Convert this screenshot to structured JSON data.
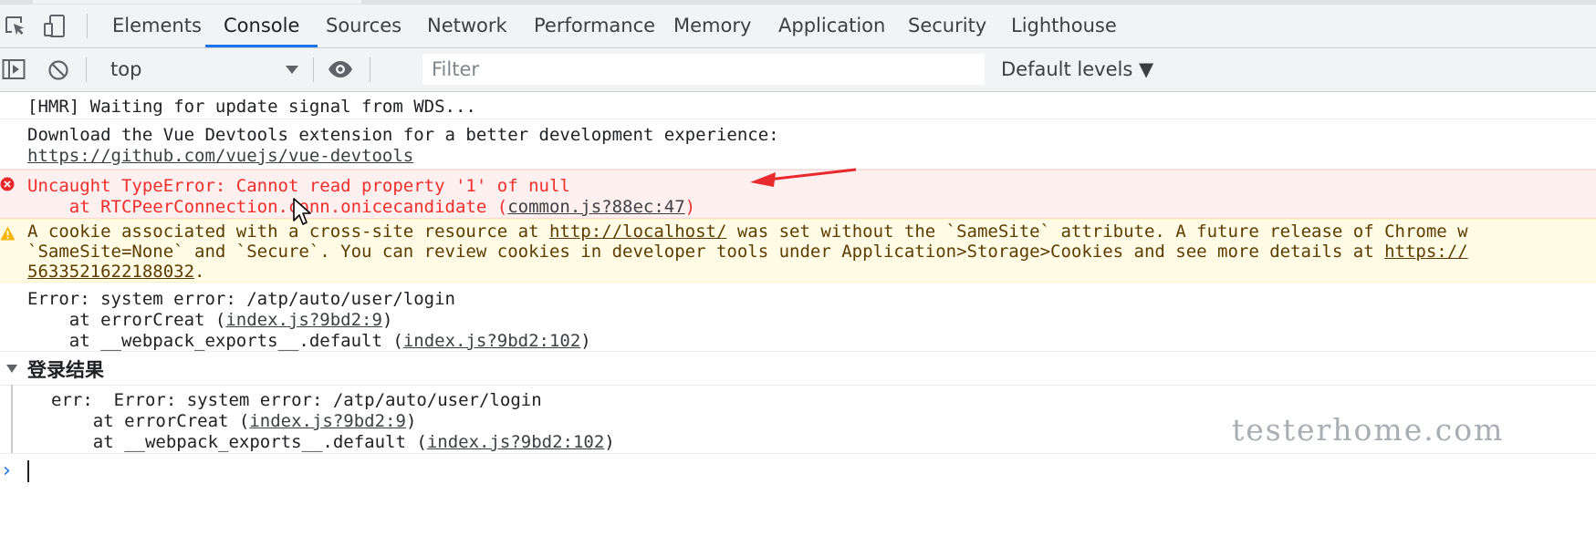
{
  "tabs": [
    {
      "label": "Elements"
    },
    {
      "label": "Console"
    },
    {
      "label": "Sources"
    },
    {
      "label": "Network"
    },
    {
      "label": "Performance"
    },
    {
      "label": "Memory"
    },
    {
      "label": "Application"
    },
    {
      "label": "Security"
    },
    {
      "label": "Lighthouse"
    }
  ],
  "active_tab": "Console",
  "toolbar": {
    "context": "top",
    "filter_placeholder": "Filter",
    "levels": "Default levels ▼"
  },
  "console": {
    "hmr": "[HMR] Waiting for update signal from WDS...",
    "vue": {
      "line1": "Download the Vue Devtools extension for a better development experience:",
      "url": "https://github.com/vuejs/vue-devtools"
    },
    "type_error": {
      "message": "Uncaught TypeError: Cannot read property '1' of null",
      "at_prefix": "    at RTCPeerConnection.conn.onicecandidate (",
      "source": "common.js?88ec:47",
      "suffix": ")"
    },
    "cookie_warning": {
      "l1_a": "A cookie associated with a cross-site resource at ",
      "l1_link": "http://localhost/",
      "l1_b": " was set without the `SameSite` attribute. A future release of Chrome w",
      "l2_a": "`SameSite=None` and `Secure`. You can review cookies in developer tools under Application>Storage>Cookies and see more details at ",
      "l2_link": "https://",
      "l3_link": "5633521622188032",
      "l3_end": "."
    },
    "system_error": {
      "line1": "Error: system error: /atp/auto/user/login",
      "l2_prefix": "    at errorCreat (",
      "l2_src": "index.js?9bd2:9",
      "l3_prefix": "    at __webpack_exports__.default (",
      "l3_src": "index.js?9bd2:102",
      "close": ")"
    },
    "group": {
      "title": "登录结果",
      "line1": "err:  Error: system error: /atp/auto/user/login",
      "l2_prefix": "    at errorCreat (",
      "l2_src": "index.js?9bd2:9",
      "l3_prefix": "    at __webpack_exports__.default (",
      "l3_src": "index.js?9bd2:102",
      "close": ")"
    }
  },
  "watermark": "testerhome.com",
  "colors": {
    "accent": "#1a73e8",
    "error_text": "#f02d2d",
    "error_bg": "#fff0f0",
    "warning_bg": "#fffbe5",
    "annotation": "#e8292e"
  },
  "icons": [
    "inspect-element-icon",
    "device-toolbar-icon",
    "sidebar-toggle-icon",
    "clear-console-icon",
    "eye-icon",
    "error-icon",
    "warning-icon",
    "mouse-cursor-icon",
    "red-arrow-annotation"
  ]
}
